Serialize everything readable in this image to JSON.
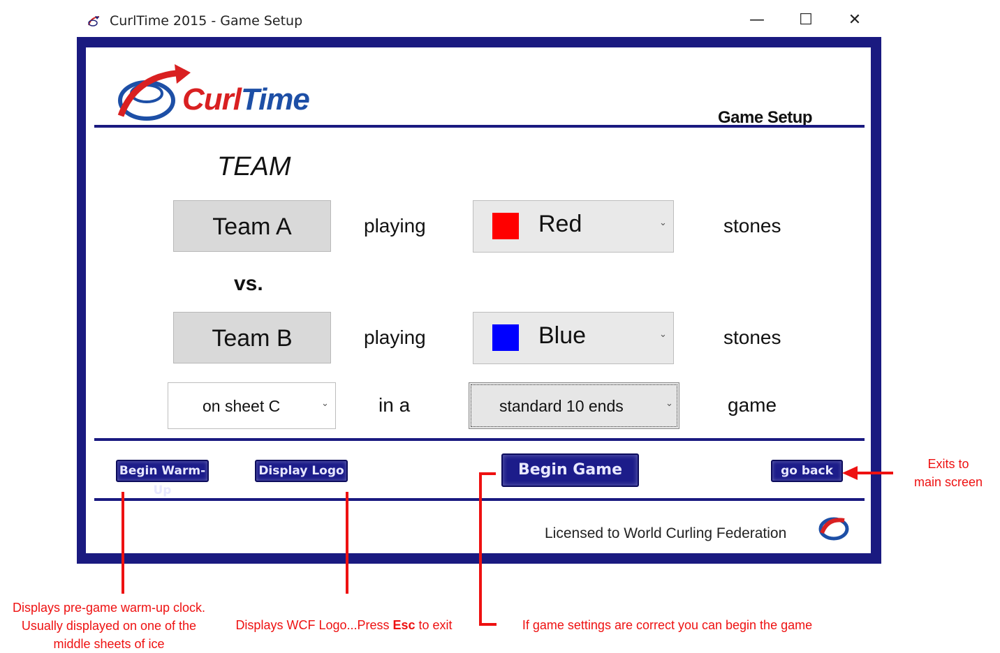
{
  "window": {
    "title": "CurlTime 2015 - Game Setup",
    "minimize": "—",
    "maximize": "☐",
    "close": "✕"
  },
  "header": {
    "logo_part1": "Curl",
    "logo_part2": "Time",
    "page_title": "Game Setup"
  },
  "setup": {
    "team_heading": "TEAM",
    "team_a": "Team A",
    "team_b": "Team B",
    "playing": "playing",
    "vs": "vs.",
    "stones": "stones",
    "team_a_color": {
      "label": "Red",
      "swatch": "#ff0000"
    },
    "team_b_color": {
      "label": "Blue",
      "swatch": "#0000ff"
    },
    "sheet": "on sheet C",
    "in_a": "in a",
    "ends": "standard 10 ends",
    "game": "game",
    "chevron": "⌄"
  },
  "buttons": {
    "warmup": "Begin Warm-Up",
    "logo": "Display Logo",
    "begin": "Begin Game",
    "back": "go back"
  },
  "footer": {
    "license": "Licensed to World Curling Federation"
  },
  "annotations": {
    "exit": [
      "Exits to",
      "main screen"
    ],
    "warmup": [
      "Displays pre-game warm-up clock.",
      "Usually displayed on one of the",
      "middle sheets of ice"
    ],
    "logo_before": "Displays WCF Logo...Press ",
    "logo_bold": "Esc",
    "logo_after": " to exit",
    "begin": "If game settings are correct you can begin the game"
  },
  "colors": {
    "frame": "#1a1a80",
    "annotation": "#e11111"
  }
}
